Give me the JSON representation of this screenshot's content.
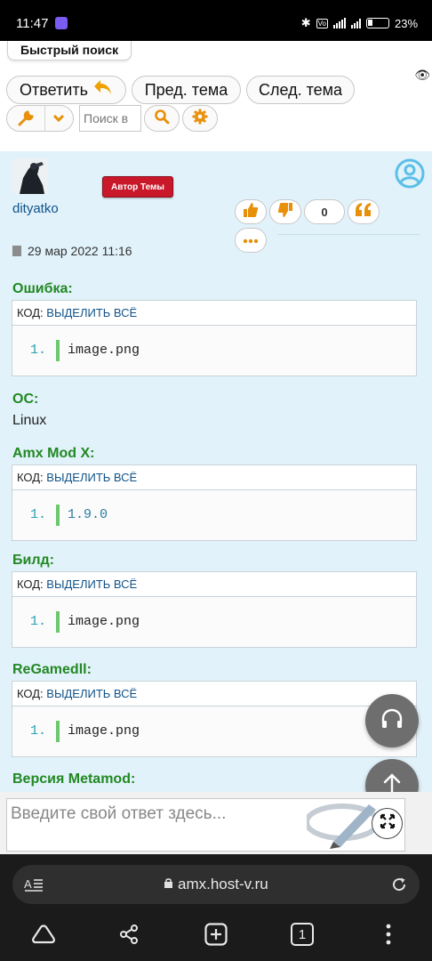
{
  "status_bar": {
    "time": "11:47",
    "battery": "23"
  },
  "toolbar": {
    "quick_search": "Быстрый поиск",
    "reply_label": "Ответить",
    "prev_label": "Пред. тема",
    "next_label": "След. тема",
    "search_placeholder": "Поиск в"
  },
  "post": {
    "username": "dityatko",
    "author_badge": "Автор Темы",
    "reaction_count": "0",
    "date": "29 мар 2022 11:16",
    "sections": [
      {
        "label": "Ошибка:",
        "code_prefix": "КОД:",
        "select_all": "ВЫДЕЛИТЬ ВСЁ",
        "line_no": "1.",
        "code": "image.png"
      },
      {
        "label": "ОС:",
        "value": "Linux"
      },
      {
        "label": "Amx Mod X:",
        "code_prefix": "КОД:",
        "select_all": "ВЫДЕЛИТЬ ВСЁ",
        "line_no": "1.",
        "code": "1.9.0"
      },
      {
        "label": "Билд:",
        "code_prefix": "КОД:",
        "select_all": "ВЫДЕЛИТЬ ВСЁ",
        "line_no": "1.",
        "code": "image.png"
      },
      {
        "label": "ReGamedll:",
        "code_prefix": "КОД:",
        "select_all": "ВЫДЕЛИТЬ ВСЁ",
        "line_no": "1.",
        "code": "image.png"
      },
      {
        "label": "Версия Metamod:"
      }
    ]
  },
  "reply_box": {
    "placeholder": "Введите свой ответ здесь..."
  },
  "browser": {
    "url": "amx.host-v.ru",
    "tab_count": "1"
  },
  "colors": {
    "label_green": "#228822",
    "link_blue": "#105289",
    "post_bg": "#e1f2fb",
    "badge_red": "#c8182a",
    "accent_orange": "#f0a000"
  }
}
